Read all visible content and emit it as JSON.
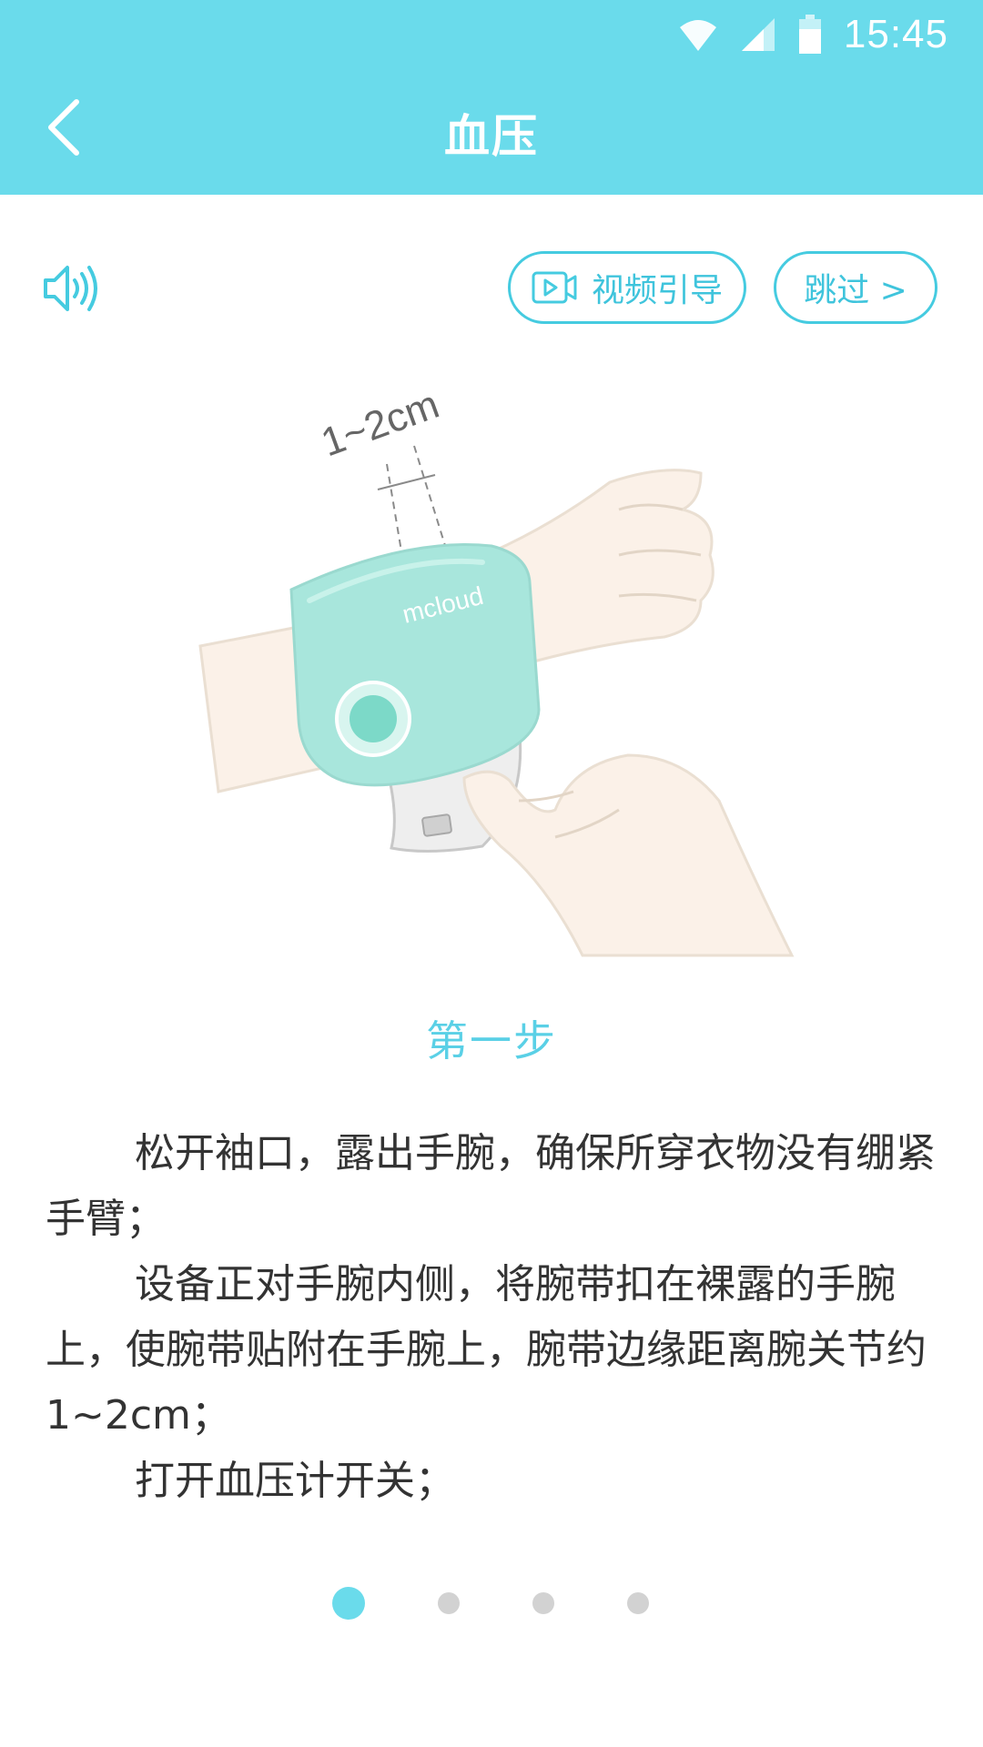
{
  "status_bar": {
    "time": "15:45",
    "icons": [
      "wifi-icon",
      "signal-icon",
      "battery-icon"
    ]
  },
  "header": {
    "title": "血压",
    "back_icon": "chevron-left-icon"
  },
  "toolbar": {
    "speaker_icon": "speaker-icon",
    "video_guide_label": "视频引导",
    "video_icon": "video-icon",
    "skip_label": "跳过 >"
  },
  "illustration": {
    "measure_label": "1~2cm",
    "brand_label": "mcloud"
  },
  "step": {
    "title": "第一步",
    "instructions": [
      "松开袖口，露出手腕，确保所穿衣物没有绷紧手臂；",
      "设备正对手腕内侧，将腕带扣在裸露的手腕上，使腕带贴附在手腕上，腕带边缘距离腕关节约1~2cm；",
      "打开血压计开关；"
    ]
  },
  "pagination": {
    "total": 4,
    "active_index": 0
  },
  "colors": {
    "primary": "#6adbeb",
    "accent_text": "#3fc4dc",
    "body_text": "#333333",
    "dot_inactive": "#d2d2d2",
    "device": "#a8e6dc"
  }
}
